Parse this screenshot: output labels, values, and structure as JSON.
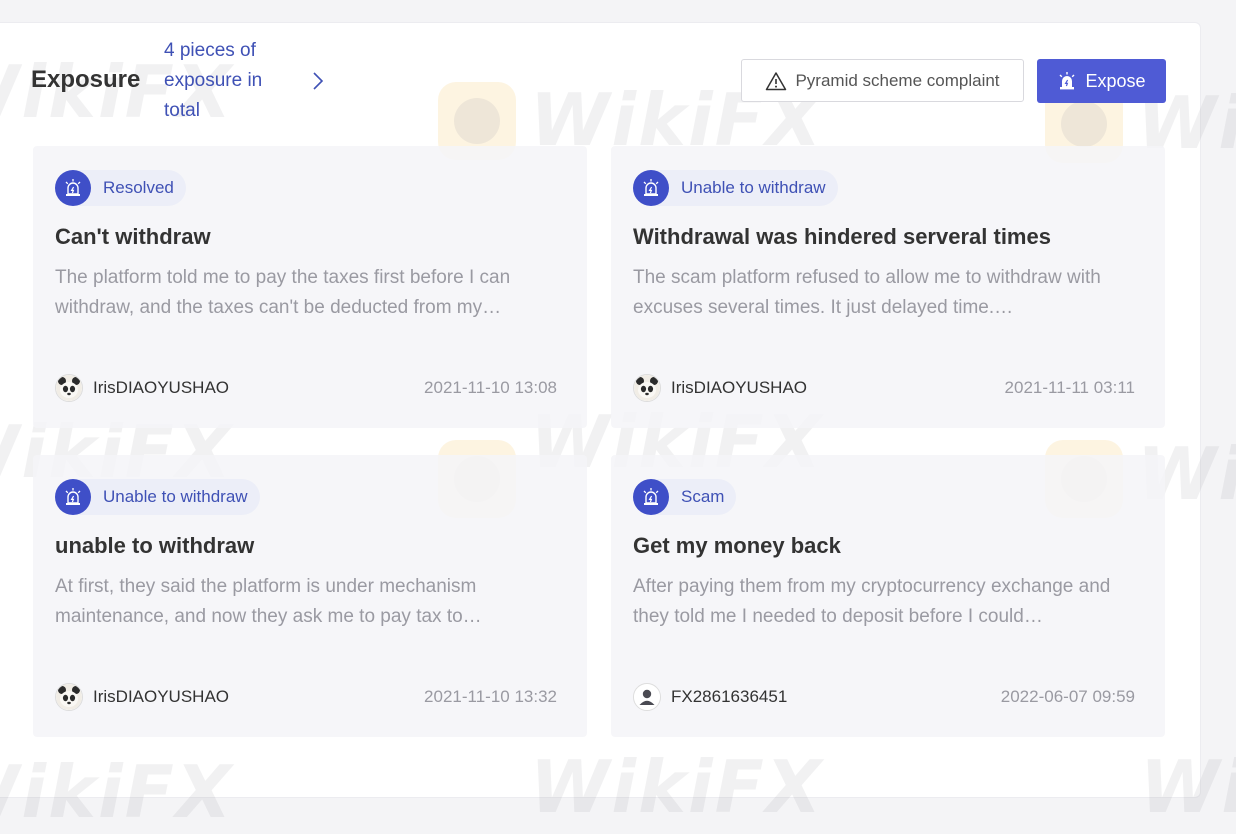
{
  "header": {
    "section_title": "Exposure",
    "summary_link": "4 pieces of exposure in total",
    "complaint_button": "Pyramid scheme complaint",
    "expose_button": "Expose"
  },
  "watermark": {
    "text": "WikiFX"
  },
  "cards": [
    {
      "tag": "Resolved",
      "title": "Can't withdraw",
      "description": "The platform told me to pay the taxes first before I can withdraw, and the taxes can't be deducted from my…",
      "author": "IrisDIAOYUSHAO",
      "avatar": "panda-avatar",
      "date": "2021-11-10 13:08"
    },
    {
      "tag": "Unable to withdraw",
      "title": "Withdrawal was hindered serveral times",
      "description": "The scam platform refused to allow me to withdraw with excuses several times. It just delayed time.…",
      "author": "IrisDIAOYUSHAO",
      "avatar": "panda-avatar",
      "date": "2021-11-11 03:11"
    },
    {
      "tag": "Unable to withdraw",
      "title": "unable to withdraw",
      "description": "At first, they said the platform is under mechanism maintenance, and now they ask me to pay tax to…",
      "author": "IrisDIAOYUSHAO",
      "avatar": "panda-avatar",
      "date": "2021-11-10 13:32"
    },
    {
      "tag": "Scam",
      "title": "Get my money back",
      "description": "After paying them from my cryptocurrency exchange and they told me I needed to deposit before I could…",
      "author": "FX2861636451",
      "avatar": "default-user-avatar",
      "date": "2022-06-07 09:59"
    }
  ],
  "colors": {
    "accent": "#3f51b5",
    "button_primary": "#4f5bd5",
    "muted_text": "#9a9aa2"
  }
}
